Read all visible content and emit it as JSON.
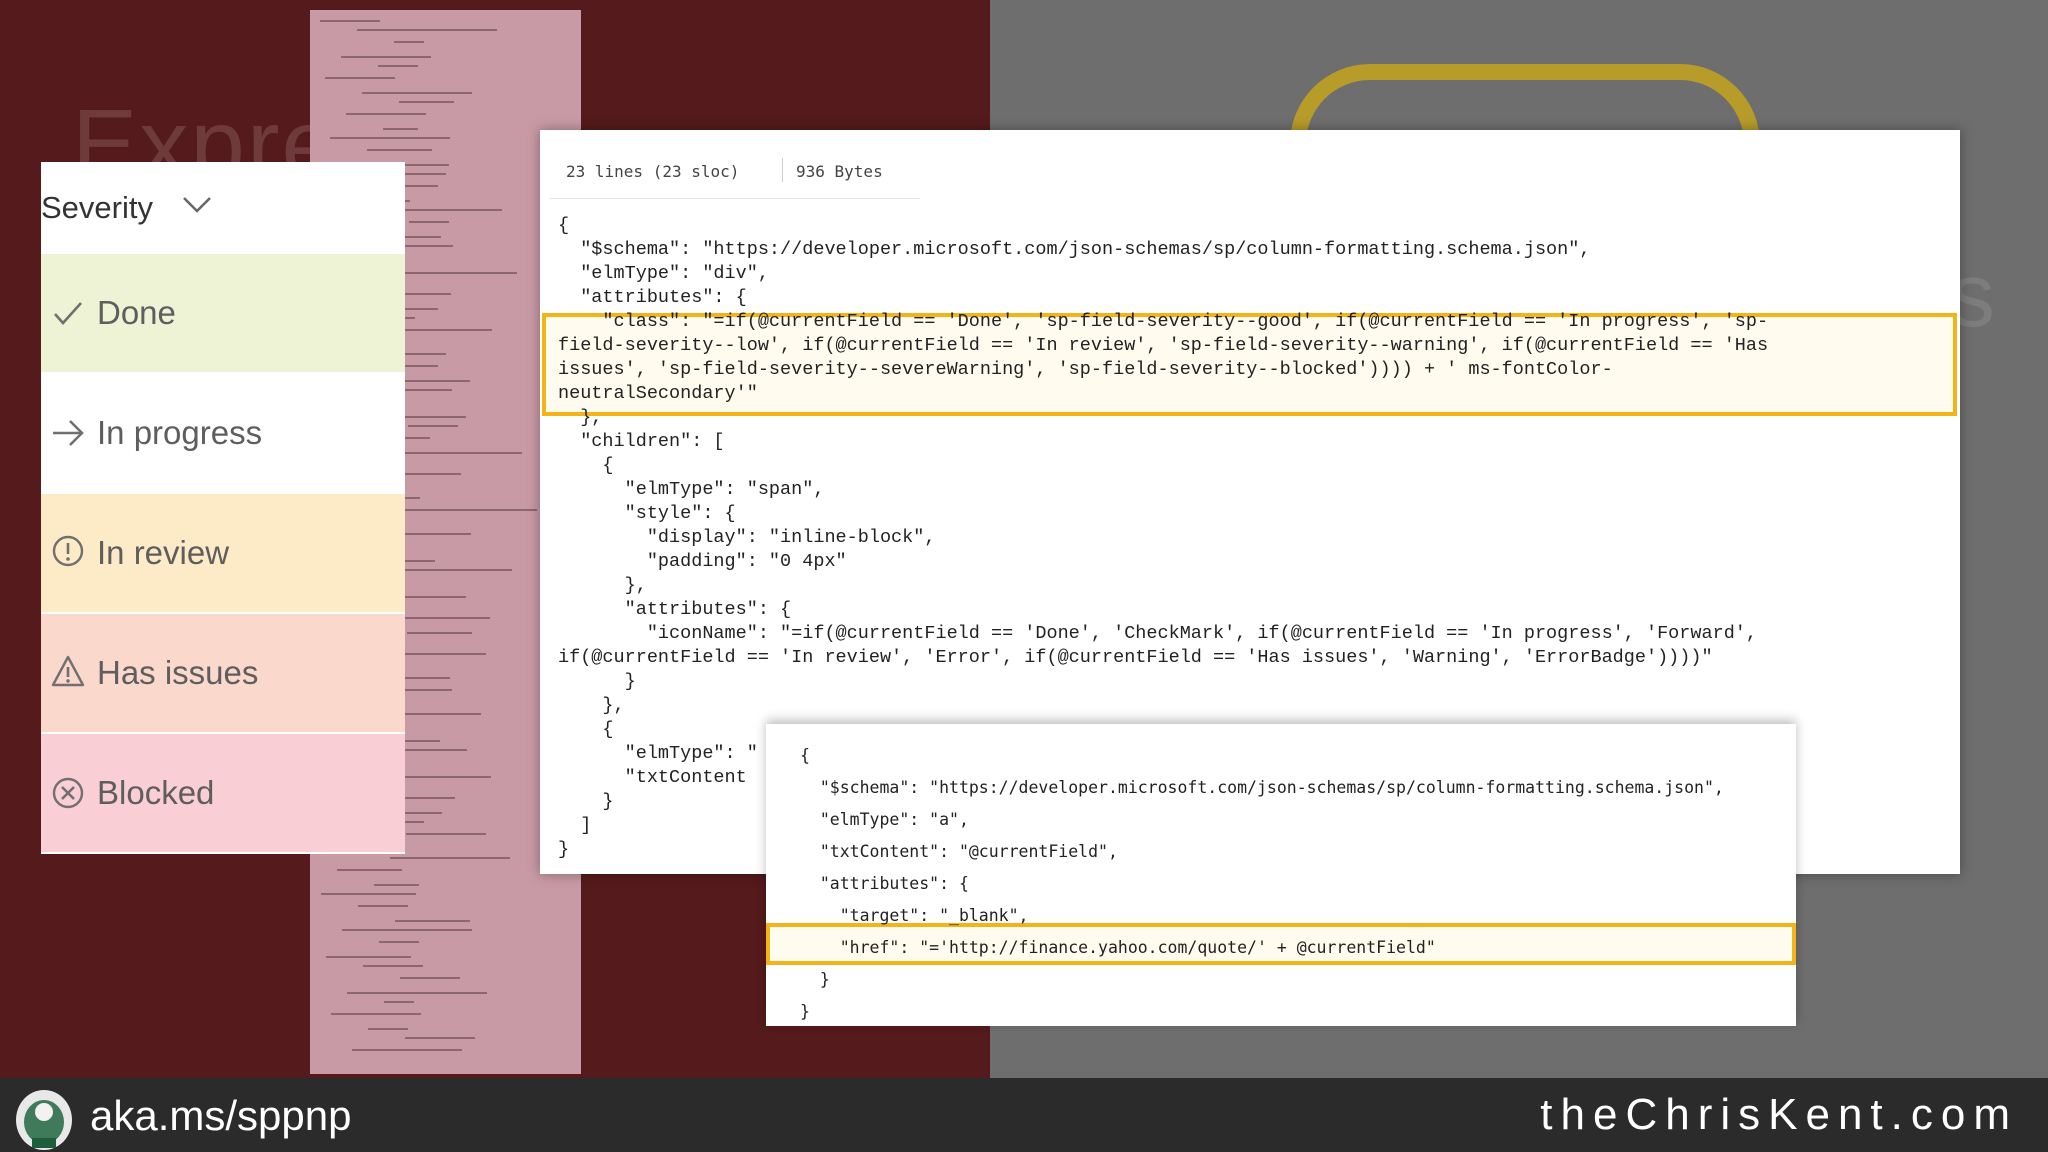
{
  "background": {
    "left_color": "#551a1b",
    "right_color": "#6e6e6e",
    "title_fragment": "Expre",
    "right_fragment": "s"
  },
  "severity_panel": {
    "header_label": "Severity",
    "header_icon": "chevron-down-icon",
    "items": [
      {
        "label": "Done",
        "icon": "checkmark-icon",
        "bg": "#eef3d5"
      },
      {
        "label": "In progress",
        "icon": "forward-arrow-icon",
        "bg": "#ffffff"
      },
      {
        "label": "In review",
        "icon": "error-circle-icon",
        "bg": "#fdebc8"
      },
      {
        "label": "Has issues",
        "icon": "warning-triangle-icon",
        "bg": "#fbd8cc"
      },
      {
        "label": "Blocked",
        "icon": "blocked-circle-icon",
        "bg": "#f9ced4"
      }
    ]
  },
  "code_file": {
    "lines_info": "23 lines (23 sloc)",
    "size_info": "936 Bytes",
    "code": "{\n  \"$schema\": \"https://developer.microsoft.com/json-schemas/sp/column-formatting.schema.json\",\n  \"elmType\": \"div\",\n  \"attributes\": {\n    \"class\": \"=if(@currentField == 'Done', 'sp-field-severity--good', if(@currentField == 'In progress', 'sp-\nfield-severity--low', if(@currentField == 'In review', 'sp-field-severity--warning', if(@currentField == 'Has\nissues', 'sp-field-severity--severeWarning', 'sp-field-severity--blocked')))) + ' ms-fontColor-\nneutralSecondary'\"\n  },\n  \"children\": [\n    {\n      \"elmType\": \"span\",\n      \"style\": {\n        \"display\": \"inline-block\",\n        \"padding\": \"0 4px\"\n      },\n      \"attributes\": {\n        \"iconName\": \"=if(@currentField == 'Done', 'CheckMark', if(@currentField == 'In progress', 'Forward',\nif(@currentField == 'In review', 'Error', if(@currentField == 'Has issues', 'Warning', 'ErrorBadge'))))\"\n      }\n    },\n    {\n      \"elmType\": \"\n      \"txtContent\n    }\n  ]\n}"
  },
  "snippet": {
    "code": "{\n  \"$schema\": \"https://developer.microsoft.com/json-schemas/sp/column-formatting.schema.json\",\n  \"elmType\": \"a\",\n  \"txtContent\": \"@currentField\",\n  \"attributes\": {\n    \"target\": \"_blank\",\n    \"href\": \"='http://finance.yahoo.com/quote/' + @currentField\"\n  }\n}"
  },
  "highlight_color": "#f2b418",
  "footer": {
    "logo_icon": "mascot-logo-icon",
    "short_link": "aka.ms/sppnp",
    "site": "theChrisKent.com"
  }
}
